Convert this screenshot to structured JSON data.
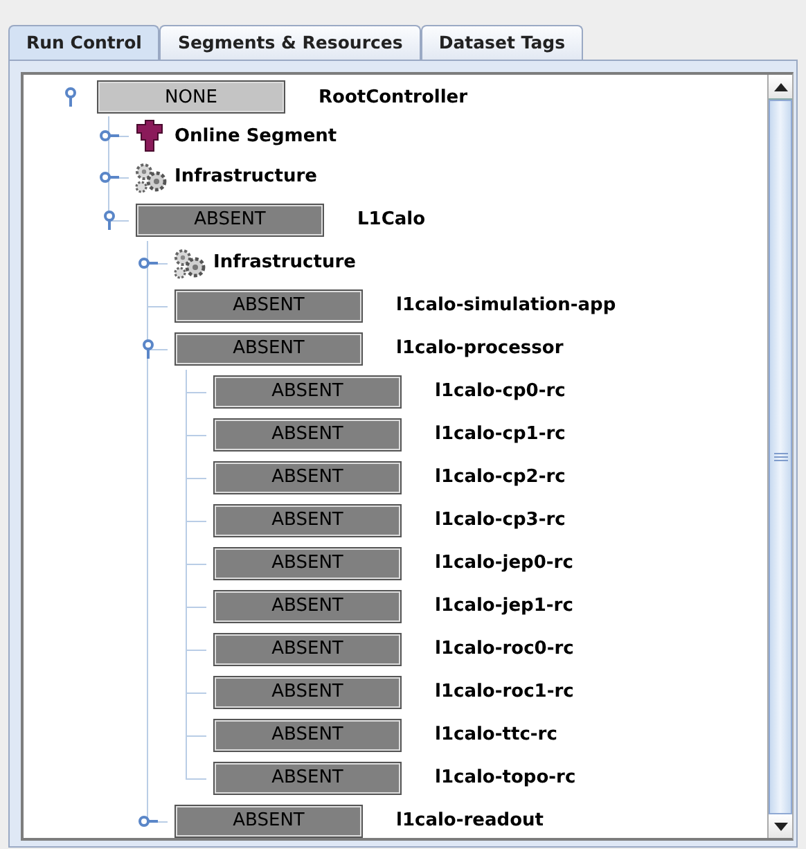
{
  "tabs": [
    {
      "label": "Run Control",
      "selected": true
    },
    {
      "label": "Segments & Resources",
      "selected": false
    },
    {
      "label": "Dataset Tags",
      "selected": false
    }
  ],
  "tree": [
    {
      "kind": "controller",
      "status": "NONE",
      "color": "#c4c4c4",
      "name": "RootController",
      "expanded": true,
      "children": [
        {
          "kind": "segment",
          "name": "Online Segment",
          "expanded": false
        },
        {
          "kind": "infrastructure",
          "name": "Infrastructure",
          "expanded": false
        },
        {
          "kind": "controller",
          "status": "ABSENT",
          "color": "#808080",
          "name": "L1Calo",
          "expanded": true,
          "children": [
            {
              "kind": "infrastructure",
              "name": "Infrastructure",
              "expanded": false
            },
            {
              "kind": "controller",
              "status": "ABSENT",
              "color": "#808080",
              "name": "l1calo-simulation-app"
            },
            {
              "kind": "controller",
              "status": "ABSENT",
              "color": "#808080",
              "name": "l1calo-processor",
              "expanded": true,
              "children": [
                {
                  "kind": "controller",
                  "status": "ABSENT",
                  "color": "#808080",
                  "name": "l1calo-cp0-rc"
                },
                {
                  "kind": "controller",
                  "status": "ABSENT",
                  "color": "#808080",
                  "name": "l1calo-cp1-rc"
                },
                {
                  "kind": "controller",
                  "status": "ABSENT",
                  "color": "#808080",
                  "name": "l1calo-cp2-rc"
                },
                {
                  "kind": "controller",
                  "status": "ABSENT",
                  "color": "#808080",
                  "name": "l1calo-cp3-rc"
                },
                {
                  "kind": "controller",
                  "status": "ABSENT",
                  "color": "#808080",
                  "name": "l1calo-jep0-rc"
                },
                {
                  "kind": "controller",
                  "status": "ABSENT",
                  "color": "#808080",
                  "name": "l1calo-jep1-rc"
                },
                {
                  "kind": "controller",
                  "status": "ABSENT",
                  "color": "#808080",
                  "name": "l1calo-roc0-rc"
                },
                {
                  "kind": "controller",
                  "status": "ABSENT",
                  "color": "#808080",
                  "name": "l1calo-roc1-rc"
                },
                {
                  "kind": "controller",
                  "status": "ABSENT",
                  "color": "#808080",
                  "name": "l1calo-ttc-rc"
                },
                {
                  "kind": "controller",
                  "status": "ABSENT",
                  "color": "#808080",
                  "name": "l1calo-topo-rc"
                }
              ]
            },
            {
              "kind": "controller",
              "status": "ABSENT",
              "color": "#808080",
              "name": "l1calo-readout",
              "expanded": false
            }
          ]
        }
      ]
    }
  ]
}
